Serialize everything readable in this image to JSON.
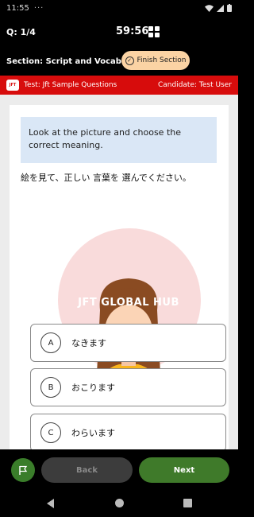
{
  "status_bar": {
    "time": "11:55",
    "dots": "···"
  },
  "header": {
    "question_counter": "Q: 1/4",
    "timer": "59:56"
  },
  "section": {
    "label": "Section: Script and Vocabulary",
    "finish_label": "Finish Section"
  },
  "test_bar": {
    "logo_text": "JFT",
    "test_name": "Test: Jft Sample Questions",
    "candidate": "Candidate: Test User"
  },
  "question": {
    "instruction": "Look at the picture and choose the correct meaning.",
    "japanese": "絵を見て、正しい 言葉を 選んでください。",
    "watermark": "JFT GLOBAL HUB",
    "options": [
      {
        "letter": "A",
        "text": "なきます"
      },
      {
        "letter": "B",
        "text": "おこります"
      },
      {
        "letter": "C",
        "text": "わらいます"
      }
    ]
  },
  "footer": {
    "back_label": "Back",
    "next_label": "Next"
  },
  "icons": {
    "flag": "flag-icon",
    "grid": "grid-icon",
    "check": "check-circle-icon"
  },
  "colors": {
    "accent_red": "#d70c0c",
    "finish_orange": "#fbd3a4",
    "next_green": "#3f7a2a",
    "instruction_blue": "#dae7f6"
  }
}
